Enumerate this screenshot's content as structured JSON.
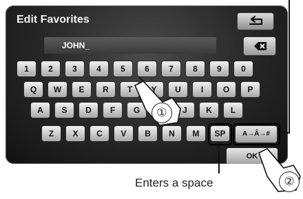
{
  "screen": {
    "title": "Edit Favorites",
    "entry_text": "JOHN_",
    "keyboard": {
      "row1": [
        "1",
        "2",
        "3",
        "4",
        "5",
        "6",
        "7",
        "8",
        "9",
        "0"
      ],
      "row2": [
        "Q",
        "W",
        "E",
        "R",
        "T",
        "Y",
        "U",
        "I",
        "O",
        "P"
      ],
      "row3": [
        "A",
        "S",
        "D",
        "F",
        "G",
        "H",
        "J",
        "K",
        "L"
      ],
      "row4": [
        "Z",
        "X",
        "C",
        "V",
        "B",
        "N",
        "M",
        "SP"
      ]
    },
    "mode_label": "A→Â→#",
    "ok_label": "OK"
  },
  "annotations": {
    "caption": "Enters a space",
    "callout1": "①",
    "callout2": "②"
  }
}
